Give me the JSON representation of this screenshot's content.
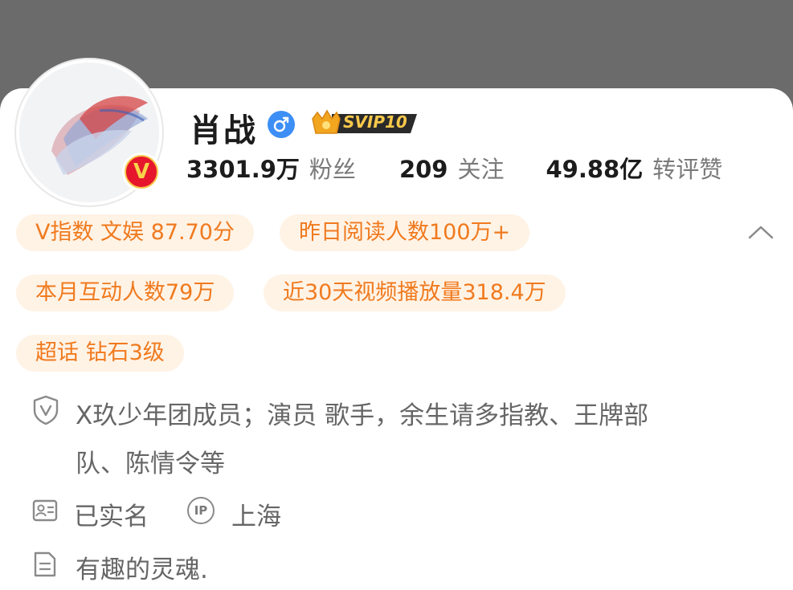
{
  "profile": {
    "name": "肖战",
    "gender_icon": "male-icon",
    "svip_label": "SVIP10",
    "verified_badge": "V",
    "stats": [
      {
        "value": "3301.9万",
        "label": "粉丝"
      },
      {
        "value": "209",
        "label": "关注"
      },
      {
        "value": "49.88亿",
        "label": "转评赞"
      }
    ]
  },
  "tags": [
    "V指数 文娱 87.70分",
    "昨日阅读人数100万+",
    "本月互动人数79万",
    "近30天视频播放量318.4万",
    "超话 钻石3级"
  ],
  "info": {
    "verification_line1": "X玖少年团成员；演员 歌手，余生请多指教、王牌部",
    "verification_line2": "队、陈情令等",
    "real_name": "已实名",
    "ip_label": "IP",
    "ip_location": "上海",
    "bio": "有趣的灵魂."
  },
  "colors": {
    "accent_orange": "#f07a1e",
    "pill_bg": "#fff3e6",
    "gender_blue": "#3d8ff5",
    "badge_red": "#e6162d",
    "badge_gold": "#f7c84b"
  }
}
